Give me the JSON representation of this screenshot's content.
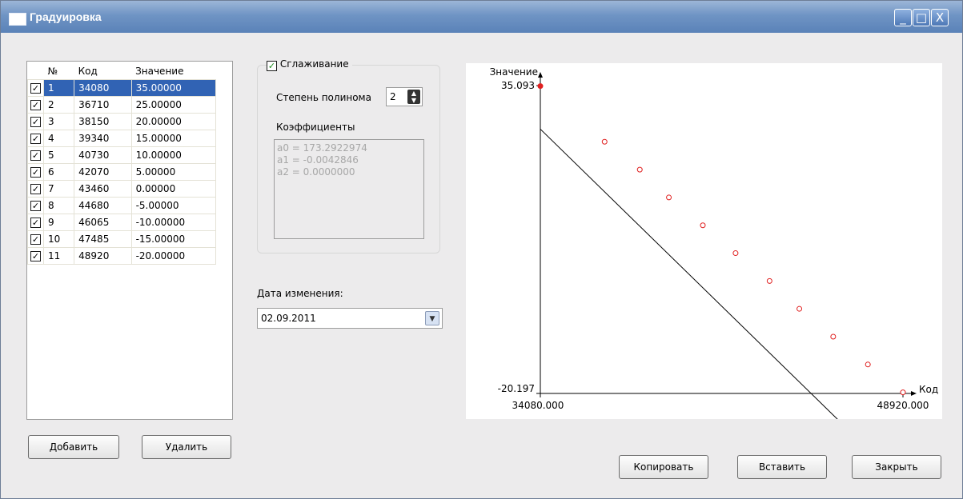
{
  "window": {
    "title": "Градуировка",
    "minimize": "_",
    "maximize": "□",
    "close": "X"
  },
  "table": {
    "headers": [
      "№",
      "Код",
      "Значение"
    ],
    "rows": [
      {
        "n": "1",
        "code": "34080",
        "value": "35.00000",
        "checked": true,
        "selected": true
      },
      {
        "n": "2",
        "code": "36710",
        "value": "25.00000",
        "checked": true
      },
      {
        "n": "3",
        "code": "38150",
        "value": "20.00000",
        "checked": true
      },
      {
        "n": "4",
        "code": "39340",
        "value": "15.00000",
        "checked": true
      },
      {
        "n": "5",
        "code": "40730",
        "value": "10.00000",
        "checked": true
      },
      {
        "n": "6",
        "code": "42070",
        "value": "5.00000",
        "checked": true
      },
      {
        "n": "7",
        "code": "43460",
        "value": "0.00000",
        "checked": true
      },
      {
        "n": "8",
        "code": "44680",
        "value": "-5.00000",
        "checked": true
      },
      {
        "n": "9",
        "code": "46065",
        "value": "-10.00000",
        "checked": true
      },
      {
        "n": "10",
        "code": "47485",
        "value": "-15.00000",
        "checked": true
      },
      {
        "n": "11",
        "code": "48920",
        "value": "-20.00000",
        "checked": true
      }
    ]
  },
  "buttons": {
    "add": "Добавить",
    "delete": "Удалить",
    "copy": "Копировать",
    "paste": "Вставить",
    "close": "Закрыть"
  },
  "smoothing": {
    "label": "Сглаживание",
    "checked": true,
    "degree_label": "Степень полинома",
    "degree": "2",
    "coeff_label": "Коэффициенты",
    "coeffs": [
      "a0 = 173.2922974",
      "a1 = -0.0042846",
      "a2 = 0.0000000"
    ]
  },
  "date": {
    "label": "Дата изменения:",
    "value": "02.09.2011"
  },
  "chart_data": {
    "type": "scatter",
    "xlabel": "Код",
    "ylabel": "Значение",
    "xlim": [
      34080,
      48920
    ],
    "ylim": [
      -20.197,
      35.093
    ],
    "xtick_labels": [
      "34080.000",
      "48920.000"
    ],
    "ytick_labels": [
      "35.093",
      "-20.197"
    ],
    "points": [
      [
        34080,
        35
      ],
      [
        36710,
        25
      ],
      [
        38150,
        20
      ],
      [
        39340,
        15
      ],
      [
        40730,
        10
      ],
      [
        42070,
        5
      ],
      [
        43460,
        0
      ],
      [
        44680,
        -5
      ],
      [
        46065,
        -10
      ],
      [
        47485,
        -15
      ],
      [
        48920,
        -20
      ]
    ],
    "fit_line": {
      "a0": 173.2922974,
      "a1": -0.0042846
    },
    "colors": {
      "points": "#e02020",
      "line": "#000000"
    }
  }
}
